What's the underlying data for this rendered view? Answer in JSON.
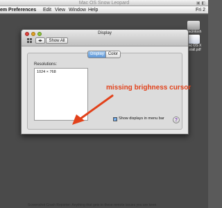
{
  "vm_window": {
    "title": "Mac OS Snow Leopard"
  },
  "menubar": {
    "app_menu": "em Preferences",
    "items": [
      "Edit",
      "View",
      "Window",
      "Help"
    ],
    "clock": "Fri 2"
  },
  "desktop_items": [
    {
      "label": "Macintosh"
    },
    {
      "label": "Mac OS X Install.pdf"
    }
  ],
  "pref_window": {
    "title": "Display",
    "show_all_label": "Show All",
    "tabs": [
      {
        "label": "Display",
        "selected": true
      },
      {
        "label": "Color",
        "selected": false
      }
    ],
    "resolutions_label": "Resolutions:",
    "resolutions": [
      "1024 × 768"
    ],
    "show_displays_label": "Show displays in menu bar",
    "show_displays_checked": true,
    "help_label": "?"
  },
  "annotation": {
    "text": "missing brighness cursor",
    "color": "#e2421b"
  },
  "bottom_text": "Screenshot Crash Reporter: Anything that gets to these remote issues you are keen"
}
